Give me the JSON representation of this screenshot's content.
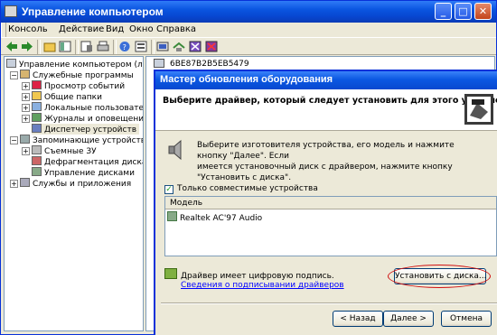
{
  "window": {
    "title": "Управление компьютером"
  },
  "window_controls": {
    "minimize": "_",
    "maximize": "□",
    "close": "✕"
  },
  "menu": [
    "Консоль",
    "Действие",
    "Вид",
    "Окно",
    "Справка"
  ],
  "tree": {
    "root": "Управление компьютером (локал",
    "items": [
      "Служебные программы",
      "Просмотр событий",
      "Общие папки",
      "Локальные пользователи",
      "Журналы и оповещения пр",
      "Диспетчер устройств",
      "Запоминающие устройства",
      "Съемные ЗУ",
      "Дефрагментация диска",
      "Управление дисками",
      "Службы и приложения"
    ]
  },
  "right_panel": {
    "header": "6BE87B2B5EB5479"
  },
  "dialog": {
    "title": "Мастер обновления оборудования",
    "heading": "Выберите драйвер, который следует установить для этого устройства.",
    "info_line1": "Выберите изготовителя устройства, его модель и нажмите кнопку \"Далее\". Если",
    "info_line2": "имеется установочный диск с драйвером, нажмите кнопку \"Установить с диска\".",
    "checkbox_label": "Только совместимые устройства",
    "checkbox_mark": "✓",
    "list_header": "Модель",
    "list_items": [
      "Realtek AC'97 Audio"
    ],
    "signed_text": "Драйвер имеет цифровую подпись.",
    "signing_link": "Сведения о подписывании драйверов",
    "have_disk": "Установить с диска...",
    "back": "< Назад",
    "next": "Далее >",
    "cancel": "Отмена"
  }
}
